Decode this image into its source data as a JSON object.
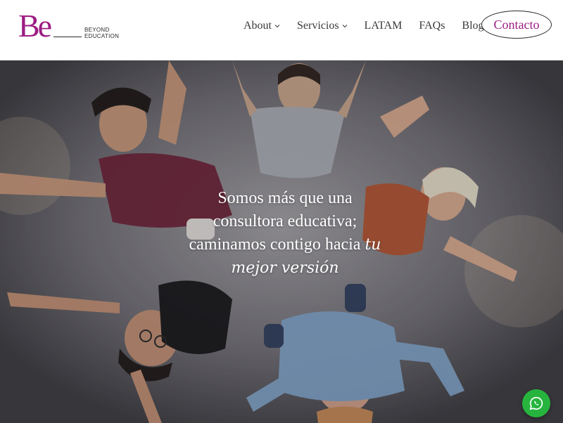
{
  "header": {
    "logo": {
      "mark": "Be",
      "line1": "BEYOND",
      "line2": "EDUCATION"
    },
    "nav": [
      {
        "label": "About",
        "has_dropdown": true
      },
      {
        "label": "Servicios",
        "has_dropdown": true
      },
      {
        "label": "LATAM",
        "has_dropdown": false
      },
      {
        "label": "FAQs",
        "has_dropdown": false
      },
      {
        "label": "Blog",
        "has_dropdown": false
      }
    ],
    "cta_label": "Contacto"
  },
  "hero": {
    "line1": "Somos más que una",
    "line2": "consultora educativa;",
    "line3": "caminamos contigo hacia",
    "emphasis_inline": "tu",
    "emphasis_line": "mejor versión"
  },
  "floating": {
    "whatsapp_icon": "whatsapp-icon"
  },
  "colors": {
    "brand": "#9c1d84",
    "whatsapp": "#27b43e",
    "text": "#3a3a3a"
  }
}
